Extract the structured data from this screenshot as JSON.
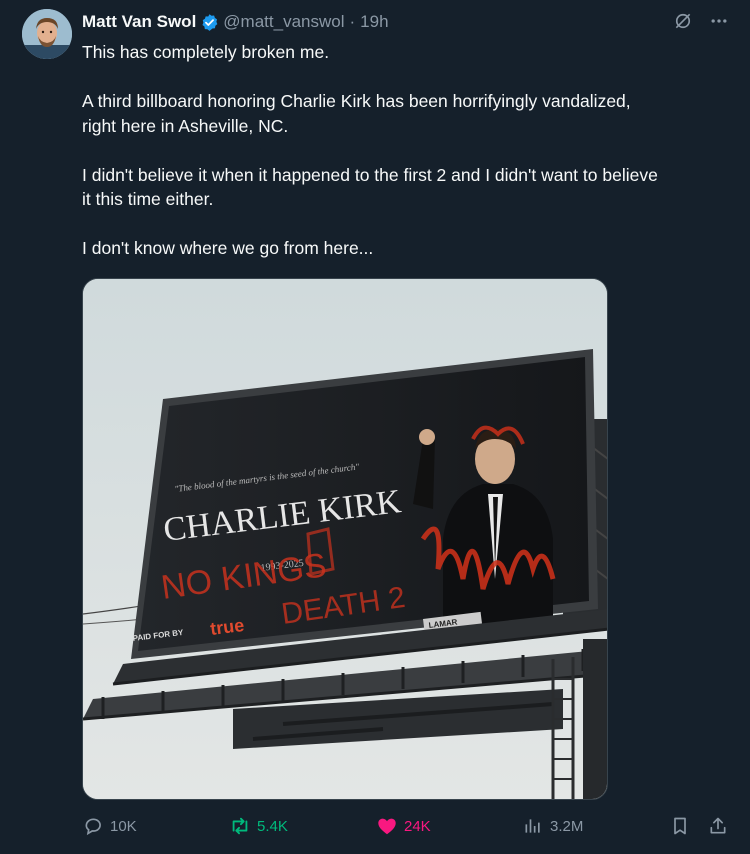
{
  "author": {
    "name": "Matt Van Swol",
    "handle": "@matt_vanswol",
    "separator": "·",
    "time": "19h",
    "verified": true
  },
  "tweet": {
    "text": "This has completely broken me.\n\nA third billboard honoring Charlie Kirk has been horrifyingly vandalized,\nright here in Asheville, NC.\n\nI didn't believe it when it happened to the first 2 and I didn't want to believe\nit this time either.\n\nI don't know where we go from here..."
  },
  "billboard": {
    "quote": "\"The blood of the martyrs is the seed of the church\"",
    "name": "CHARLIE KIRK",
    "years": "1993-2025",
    "paid_for_by": "PAID FOR BY",
    "sponsor": "true",
    "operator": "LAMAR",
    "graffiti_1": "NO KINGS",
    "graffiti_2": "DEATH 2"
  },
  "actions": {
    "replies": "10K",
    "reposts": "5.4K",
    "likes": "24K",
    "views": "3.2M"
  },
  "colors": {
    "background": "#15202b",
    "muted": "#8b98a5",
    "verified": "#1d9bf0",
    "repost": "#00ba7c",
    "like": "#f91880"
  },
  "icons": [
    "verified-badge-icon",
    "grok-icon",
    "more-icon",
    "reply-icon",
    "repost-icon",
    "like-icon",
    "views-icon",
    "bookmark-icon",
    "share-icon"
  ]
}
